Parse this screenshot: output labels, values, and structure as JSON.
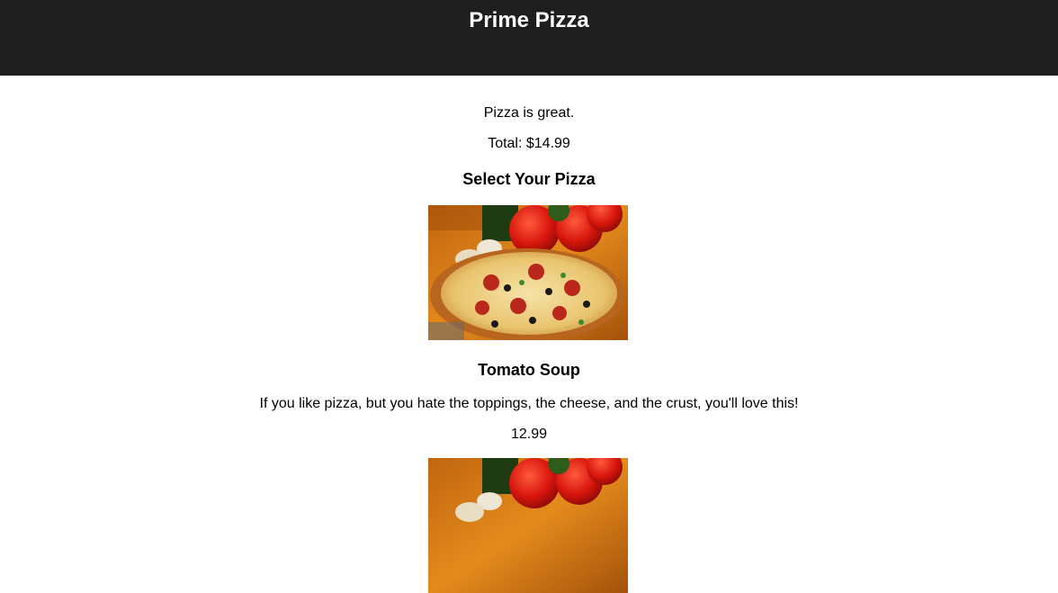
{
  "header": {
    "title": "Prime Pizza"
  },
  "intro": {
    "tagline": "Pizza is great.",
    "total": "Total: $14.99"
  },
  "section": {
    "heading": "Select Your Pizza"
  },
  "items": [
    {
      "image": "pizza-photo",
      "name": "Tomato Soup",
      "description": "If you like pizza, but you hate the toppings, the cheese, and the crust, you'll love this!",
      "price": "12.99"
    },
    {
      "image": "pizza-photo"
    }
  ],
  "colors": {
    "header_bg": "#1e1e1e",
    "header_text": "#ffffff",
    "body_text": "#000000"
  }
}
